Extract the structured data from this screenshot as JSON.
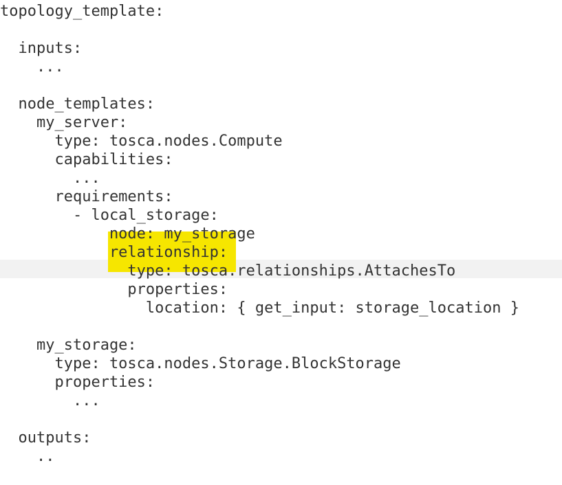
{
  "code": {
    "lines": [
      "topology_template:",
      "",
      "  inputs:",
      "    ...",
      "",
      "  node_templates:",
      "    my_server:",
      "      type: tosca.nodes.Compute",
      "      capabilities:",
      "        ...",
      "      requirements:",
      "        - local_storage:",
      "            node: my_storage",
      "            relationship:",
      "              type: tosca.relationships.AttachesTo",
      "              properties:",
      "                location: { get_input: storage_location }",
      "",
      "    my_storage:",
      "      type: tosca.nodes.Storage.BlockStorage",
      "      properties:",
      "        ...",
      "",
      "  outputs:",
      "    .."
    ],
    "highlight_color": "#f6e600",
    "current_line_color": "#f2f2f2",
    "text_color": "#333333"
  }
}
